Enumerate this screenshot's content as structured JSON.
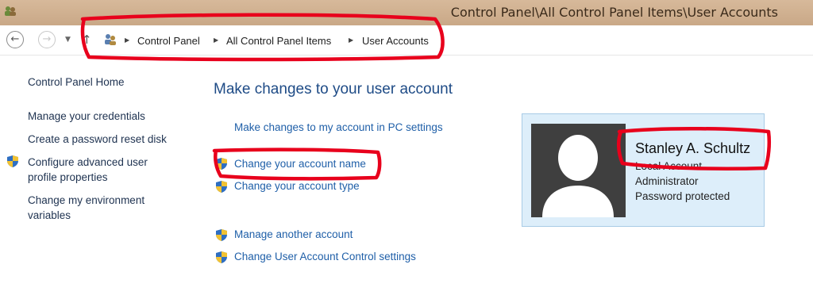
{
  "window": {
    "title": "Control Panel\\All Control Panel Items\\User Accounts"
  },
  "addressbar": {
    "back_icon": "arrow-left",
    "forward_icon": "arrow-right",
    "breadcrumbs": [
      "Control Panel",
      "All Control Panel Items",
      "User Accounts"
    ]
  },
  "sidebar": {
    "items": [
      {
        "label": "Control Panel Home",
        "shield": false
      },
      {
        "label": "Manage your credentials",
        "shield": false
      },
      {
        "label": "Create a password reset disk",
        "shield": false
      },
      {
        "label": "Configure advanced user profile properties",
        "shield": true
      },
      {
        "label": "Change my environment variables",
        "shield": false
      }
    ]
  },
  "main": {
    "heading": "Make changes to your user account",
    "tasks": [
      {
        "label": "Make changes to my account in PC settings",
        "shield": false
      },
      {
        "label": "Change your account name",
        "shield": true
      },
      {
        "label": "Change your account type",
        "shield": true
      }
    ],
    "other_tasks": [
      {
        "label": "Manage another account",
        "shield": true
      },
      {
        "label": "Change User Account Control settings",
        "shield": true
      }
    ]
  },
  "account": {
    "name": "Stanley A. Schultz",
    "details": [
      "Local Account",
      "Administrator",
      "Password protected"
    ]
  },
  "colors": {
    "annotation": "#e8001c",
    "link": "#1f5fa8",
    "heading": "#1e4b86",
    "card_bg": "#ddeefa"
  }
}
